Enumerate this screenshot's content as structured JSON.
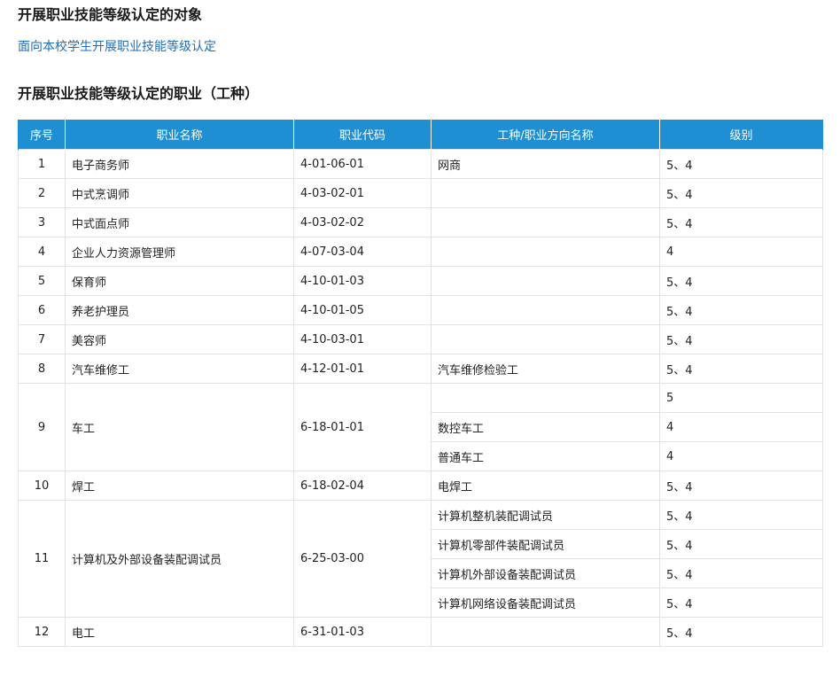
{
  "sections": {
    "target_heading": "开展职业技能等级认定的对象",
    "target_text": "面向本校学生开展职业技能等级认定",
    "occupation_heading": "开展职业技能等级认定的职业（工种）"
  },
  "table": {
    "headers": [
      "序号",
      "职业名称",
      "职业代码",
      "工种/职业方向名称",
      "级别"
    ],
    "rows": [
      {
        "no": "1",
        "name": "电子商务师",
        "code": "4-01-06-01",
        "subs": [
          {
            "direction": "网商",
            "level": "5、4"
          }
        ]
      },
      {
        "no": "2",
        "name": "中式烹调师",
        "code": "4-03-02-01",
        "subs": [
          {
            "direction": "",
            "level": "5、4"
          }
        ]
      },
      {
        "no": "3",
        "name": "中式面点师",
        "code": "4-03-02-02",
        "subs": [
          {
            "direction": "",
            "level": "5、4"
          }
        ]
      },
      {
        "no": "4",
        "name": "企业人力资源管理师",
        "code": "4-07-03-04",
        "subs": [
          {
            "direction": "",
            "level": "4"
          }
        ]
      },
      {
        "no": "5",
        "name": "保育师",
        "code": "4-10-01-03",
        "subs": [
          {
            "direction": "",
            "level": "5、4"
          }
        ]
      },
      {
        "no": "6",
        "name": "养老护理员",
        "code": "4-10-01-05",
        "subs": [
          {
            "direction": "",
            "level": "5、4"
          }
        ]
      },
      {
        "no": "7",
        "name": "美容师",
        "code": "4-10-03-01",
        "subs": [
          {
            "direction": "",
            "level": "5、4"
          }
        ]
      },
      {
        "no": "8",
        "name": "汽车维修工",
        "code": "4-12-01-01",
        "subs": [
          {
            "direction": "汽车维修检验工",
            "level": "5、4"
          }
        ]
      },
      {
        "no": "9",
        "name": "车工",
        "code": "6-18-01-01",
        "subs": [
          {
            "direction": "",
            "level": "5"
          },
          {
            "direction": "数控车工",
            "level": "4"
          },
          {
            "direction": "普通车工",
            "level": "4"
          }
        ]
      },
      {
        "no": "10",
        "name": "焊工",
        "code": "6-18-02-04",
        "subs": [
          {
            "direction": "电焊工",
            "level": "5、4"
          }
        ]
      },
      {
        "no": "11",
        "name": "计算机及外部设备装配调试员",
        "code": "6-25-03-00",
        "subs": [
          {
            "direction": "计算机整机装配调试员",
            "level": "5、4"
          },
          {
            "direction": "计算机零部件装配调试员",
            "level": "5、4"
          },
          {
            "direction": "计算机外部设备装配调试员",
            "level": "5、4"
          },
          {
            "direction": "计算机网络设备装配调试员",
            "level": "5、4"
          }
        ]
      },
      {
        "no": "12",
        "name": "电工",
        "code": "6-31-01-03",
        "subs": [
          {
            "direction": "",
            "level": "5、4"
          }
        ]
      }
    ]
  },
  "colors": {
    "header_bg": "#1e8fd2",
    "link_text": "#1f6fb5",
    "cell_border": "#e2e2e2"
  }
}
